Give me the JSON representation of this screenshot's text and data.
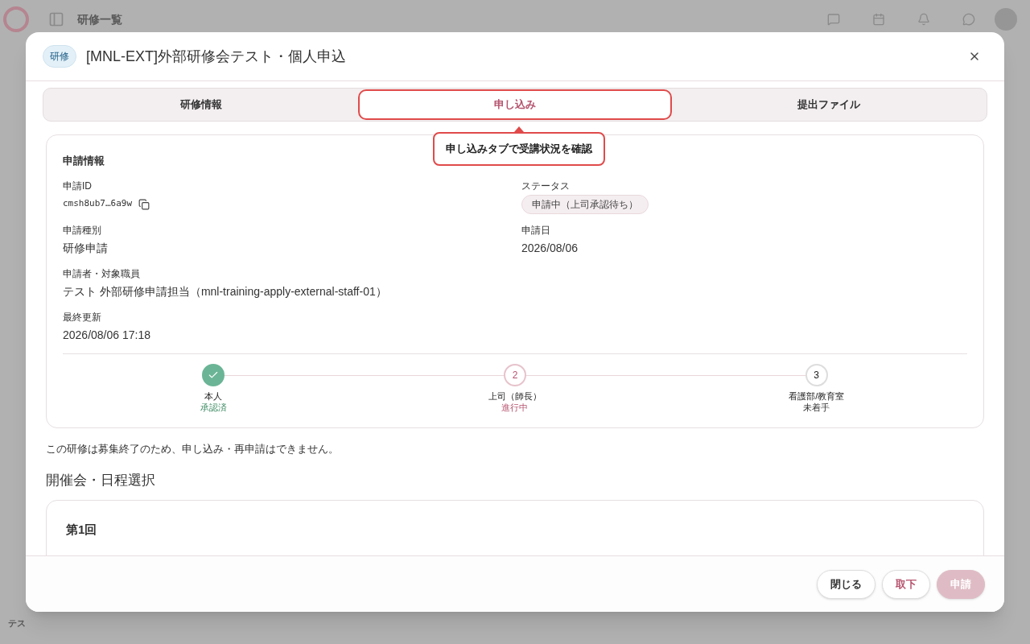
{
  "background": {
    "page_title": "研修一覧",
    "avatar": "テス"
  },
  "dialog": {
    "badge": "研修",
    "title": "[MNL-EXT]外部研修会テスト・個人申込",
    "tabs": [
      {
        "label": "研修情報",
        "selected": false
      },
      {
        "label": "申し込み",
        "selected": true
      },
      {
        "label": "提出ファイル",
        "selected": false
      }
    ],
    "callout": "申し込みタブで受講状況を確認",
    "application": {
      "heading": "申請情報",
      "fields": [
        {
          "label": "申請ID",
          "value": "cmsh8ub7…6a9w",
          "kind": "id"
        },
        {
          "label": "ステータス",
          "value": "申請中（上司承認待ち）",
          "kind": "status"
        },
        {
          "label": "申請種別",
          "value": "研修申請",
          "kind": "text"
        },
        {
          "label": "申請日",
          "value": "2026/08/06",
          "kind": "text"
        },
        {
          "label": "申請者・対象職員",
          "value": "テスト 外部研修申請担当（mnl-training-apply-external-staff-01）",
          "kind": "wide"
        },
        {
          "label": "最終更新",
          "value": "2026/08/06 17:18",
          "kind": "wide"
        }
      ],
      "steps": [
        {
          "name": "本人",
          "state_label": "承認済",
          "kind": "done"
        },
        {
          "marker": "2",
          "name": "上司（師長）",
          "state_label": "進行中",
          "kind": "current"
        },
        {
          "marker": "3",
          "name": "看護部/教育室",
          "state_label": "未着手",
          "kind": "pending"
        }
      ]
    },
    "notice": "この研修は募集終了のため、申し込み・再申請はできません。",
    "section_title": "開催会・日程選択",
    "session_title": "第1回",
    "buttons": [
      {
        "label": "閉じる",
        "kind": "neutral",
        "disabled": false
      },
      {
        "label": "取下",
        "kind": "accent",
        "disabled": false
      },
      {
        "label": "申請",
        "kind": "primary",
        "disabled": true
      }
    ]
  }
}
